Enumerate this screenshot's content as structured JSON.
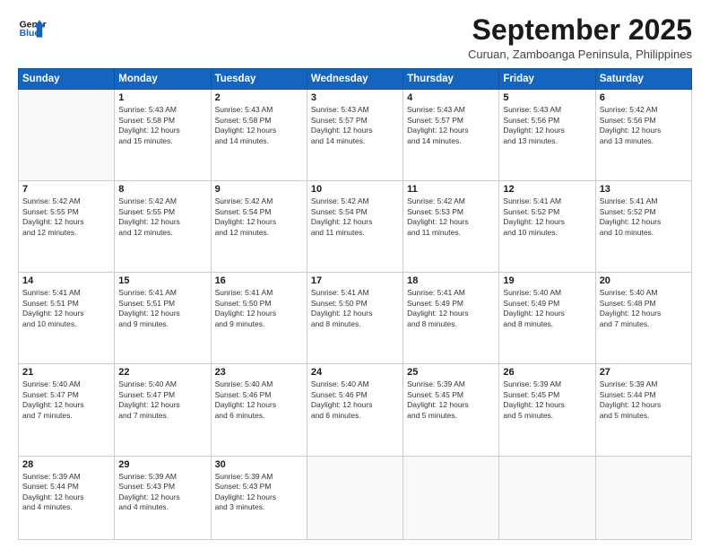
{
  "logo": {
    "line1": "General",
    "line2": "Blue"
  },
  "title": "September 2025",
  "subtitle": "Curuan, Zamboanga Peninsula, Philippines",
  "days_header": [
    "Sunday",
    "Monday",
    "Tuesday",
    "Wednesday",
    "Thursday",
    "Friday",
    "Saturday"
  ],
  "weeks": [
    [
      {
        "num": "",
        "info": ""
      },
      {
        "num": "1",
        "info": "Sunrise: 5:43 AM\nSunset: 5:58 PM\nDaylight: 12 hours\nand 15 minutes."
      },
      {
        "num": "2",
        "info": "Sunrise: 5:43 AM\nSunset: 5:58 PM\nDaylight: 12 hours\nand 14 minutes."
      },
      {
        "num": "3",
        "info": "Sunrise: 5:43 AM\nSunset: 5:57 PM\nDaylight: 12 hours\nand 14 minutes."
      },
      {
        "num": "4",
        "info": "Sunrise: 5:43 AM\nSunset: 5:57 PM\nDaylight: 12 hours\nand 14 minutes."
      },
      {
        "num": "5",
        "info": "Sunrise: 5:43 AM\nSunset: 5:56 PM\nDaylight: 12 hours\nand 13 minutes."
      },
      {
        "num": "6",
        "info": "Sunrise: 5:42 AM\nSunset: 5:56 PM\nDaylight: 12 hours\nand 13 minutes."
      }
    ],
    [
      {
        "num": "7",
        "info": "Sunrise: 5:42 AM\nSunset: 5:55 PM\nDaylight: 12 hours\nand 12 minutes."
      },
      {
        "num": "8",
        "info": "Sunrise: 5:42 AM\nSunset: 5:55 PM\nDaylight: 12 hours\nand 12 minutes."
      },
      {
        "num": "9",
        "info": "Sunrise: 5:42 AM\nSunset: 5:54 PM\nDaylight: 12 hours\nand 12 minutes."
      },
      {
        "num": "10",
        "info": "Sunrise: 5:42 AM\nSunset: 5:54 PM\nDaylight: 12 hours\nand 11 minutes."
      },
      {
        "num": "11",
        "info": "Sunrise: 5:42 AM\nSunset: 5:53 PM\nDaylight: 12 hours\nand 11 minutes."
      },
      {
        "num": "12",
        "info": "Sunrise: 5:41 AM\nSunset: 5:52 PM\nDaylight: 12 hours\nand 10 minutes."
      },
      {
        "num": "13",
        "info": "Sunrise: 5:41 AM\nSunset: 5:52 PM\nDaylight: 12 hours\nand 10 minutes."
      }
    ],
    [
      {
        "num": "14",
        "info": "Sunrise: 5:41 AM\nSunset: 5:51 PM\nDaylight: 12 hours\nand 10 minutes."
      },
      {
        "num": "15",
        "info": "Sunrise: 5:41 AM\nSunset: 5:51 PM\nDaylight: 12 hours\nand 9 minutes."
      },
      {
        "num": "16",
        "info": "Sunrise: 5:41 AM\nSunset: 5:50 PM\nDaylight: 12 hours\nand 9 minutes."
      },
      {
        "num": "17",
        "info": "Sunrise: 5:41 AM\nSunset: 5:50 PM\nDaylight: 12 hours\nand 8 minutes."
      },
      {
        "num": "18",
        "info": "Sunrise: 5:41 AM\nSunset: 5:49 PM\nDaylight: 12 hours\nand 8 minutes."
      },
      {
        "num": "19",
        "info": "Sunrise: 5:40 AM\nSunset: 5:49 PM\nDaylight: 12 hours\nand 8 minutes."
      },
      {
        "num": "20",
        "info": "Sunrise: 5:40 AM\nSunset: 5:48 PM\nDaylight: 12 hours\nand 7 minutes."
      }
    ],
    [
      {
        "num": "21",
        "info": "Sunrise: 5:40 AM\nSunset: 5:47 PM\nDaylight: 12 hours\nand 7 minutes."
      },
      {
        "num": "22",
        "info": "Sunrise: 5:40 AM\nSunset: 5:47 PM\nDaylight: 12 hours\nand 7 minutes."
      },
      {
        "num": "23",
        "info": "Sunrise: 5:40 AM\nSunset: 5:46 PM\nDaylight: 12 hours\nand 6 minutes."
      },
      {
        "num": "24",
        "info": "Sunrise: 5:40 AM\nSunset: 5:46 PM\nDaylight: 12 hours\nand 6 minutes."
      },
      {
        "num": "25",
        "info": "Sunrise: 5:39 AM\nSunset: 5:45 PM\nDaylight: 12 hours\nand 5 minutes."
      },
      {
        "num": "26",
        "info": "Sunrise: 5:39 AM\nSunset: 5:45 PM\nDaylight: 12 hours\nand 5 minutes."
      },
      {
        "num": "27",
        "info": "Sunrise: 5:39 AM\nSunset: 5:44 PM\nDaylight: 12 hours\nand 5 minutes."
      }
    ],
    [
      {
        "num": "28",
        "info": "Sunrise: 5:39 AM\nSunset: 5:44 PM\nDaylight: 12 hours\nand 4 minutes."
      },
      {
        "num": "29",
        "info": "Sunrise: 5:39 AM\nSunset: 5:43 PM\nDaylight: 12 hours\nand 4 minutes."
      },
      {
        "num": "30",
        "info": "Sunrise: 5:39 AM\nSunset: 5:43 PM\nDaylight: 12 hours\nand 3 minutes."
      },
      {
        "num": "",
        "info": ""
      },
      {
        "num": "",
        "info": ""
      },
      {
        "num": "",
        "info": ""
      },
      {
        "num": "",
        "info": ""
      }
    ]
  ]
}
